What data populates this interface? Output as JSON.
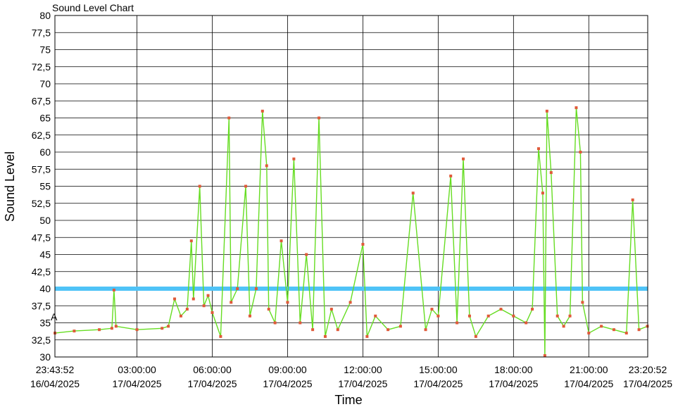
{
  "chart_data": {
    "type": "line",
    "title": "Sound Level Chart",
    "xlabel": "Time",
    "ylabel": "Sound Level",
    "ylim": [
      30,
      80
    ],
    "y_ticks": [
      "80",
      "77,5",
      "75",
      "72,5",
      "70",
      "67,5",
      "65",
      "62,5",
      "60",
      "57,5",
      "55",
      "52,5",
      "50",
      "47,5",
      "45",
      "42,5",
      "40",
      "37,5",
      "35",
      "32,5",
      "30"
    ],
    "x_range": [
      "2025-04-16 23:43:52",
      "2025-04-17 23:20:52"
    ],
    "x_ticks": [
      {
        "time": "23:43:52",
        "date": "16/04/2025"
      },
      {
        "time": "03:00:00",
        "date": "17/04/2025"
      },
      {
        "time": "06:00:00",
        "date": "17/04/2025"
      },
      {
        "time": "09:00:00",
        "date": "17/04/2025"
      },
      {
        "time": "12:00:00",
        "date": "17/04/2025"
      },
      {
        "time": "15:00:00",
        "date": "17/04/2025"
      },
      {
        "time": "18:00:00",
        "date": "17/04/2025"
      },
      {
        "time": "21:00:00",
        "date": "17/04/2025"
      },
      {
        "time": "23:20:52",
        "date": "17/04/2025"
      }
    ],
    "grid": true,
    "threshold": {
      "value": 40,
      "color": "#4fc3f7"
    },
    "marker_label": "A",
    "series": [
      {
        "color": "#66dd22",
        "marker_color": "#e05a3a",
        "x": [
          "2025-04-16 23:44",
          "2025-04-17 00:30",
          "2025-04-17 01:30",
          "2025-04-17 02:00",
          "2025-04-17 02:05",
          "2025-04-17 02:10",
          "2025-04-17 03:00",
          "2025-04-17 04:00",
          "2025-04-17 04:15",
          "2025-04-17 04:30",
          "2025-04-17 04:45",
          "2025-04-17 05:00",
          "2025-04-17 05:10",
          "2025-04-17 05:15",
          "2025-04-17 05:30",
          "2025-04-17 05:40",
          "2025-04-17 05:50",
          "2025-04-17 06:00",
          "2025-04-17 06:20",
          "2025-04-17 06:40",
          "2025-04-17 06:45",
          "2025-04-17 07:00",
          "2025-04-17 07:20",
          "2025-04-17 07:30",
          "2025-04-17 07:45",
          "2025-04-17 08:00",
          "2025-04-17 08:10",
          "2025-04-17 08:15",
          "2025-04-17 08:30",
          "2025-04-17 08:45",
          "2025-04-17 09:00",
          "2025-04-17 09:15",
          "2025-04-17 09:30",
          "2025-04-17 09:45",
          "2025-04-17 10:00",
          "2025-04-17 10:15",
          "2025-04-17 10:30",
          "2025-04-17 10:45",
          "2025-04-17 11:00",
          "2025-04-17 11:30",
          "2025-04-17 12:00",
          "2025-04-17 12:10",
          "2025-04-17 12:30",
          "2025-04-17 13:00",
          "2025-04-17 13:30",
          "2025-04-17 14:00",
          "2025-04-17 14:30",
          "2025-04-17 14:45",
          "2025-04-17 15:00",
          "2025-04-17 15:30",
          "2025-04-17 15:45",
          "2025-04-17 16:00",
          "2025-04-17 16:15",
          "2025-04-17 16:30",
          "2025-04-17 17:00",
          "2025-04-17 17:30",
          "2025-04-17 18:00",
          "2025-04-17 18:30",
          "2025-04-17 18:45",
          "2025-04-17 19:00",
          "2025-04-17 19:10",
          "2025-04-17 19:15",
          "2025-04-17 19:20",
          "2025-04-17 19:30",
          "2025-04-17 19:45",
          "2025-04-17 20:00",
          "2025-04-17 20:15",
          "2025-04-17 20:30",
          "2025-04-17 20:40",
          "2025-04-17 20:45",
          "2025-04-17 21:00",
          "2025-04-17 21:30",
          "2025-04-17 22:00",
          "2025-04-17 22:30",
          "2025-04-17 22:45",
          "2025-04-17 23:00",
          "2025-04-17 23:20"
        ],
        "y": [
          33.5,
          33.8,
          34.0,
          34.2,
          39.8,
          34.5,
          34.0,
          34.2,
          34.5,
          38.5,
          36.0,
          37.0,
          47.0,
          38.5,
          55.0,
          37.5,
          39.0,
          36.5,
          33.0,
          65.0,
          38.0,
          40.0,
          55.0,
          36.0,
          40.0,
          66.0,
          58.0,
          37.0,
          35.0,
          47.0,
          38.0,
          59.0,
          35.0,
          45.0,
          34.0,
          65.0,
          33.0,
          37.0,
          34.0,
          38.0,
          46.5,
          33.0,
          36.0,
          34.0,
          34.5,
          54.0,
          34.0,
          37.0,
          36.0,
          56.5,
          35.0,
          59.0,
          36.0,
          33.0,
          36.0,
          37.0,
          36.0,
          35.0,
          37.0,
          60.5,
          54.0,
          30.2,
          66.0,
          57.0,
          36.0,
          34.5,
          36.0,
          66.5,
          60.0,
          38.0,
          33.5,
          34.5,
          34.0,
          33.5,
          53.0,
          34.0,
          34.5
        ]
      }
    ]
  }
}
